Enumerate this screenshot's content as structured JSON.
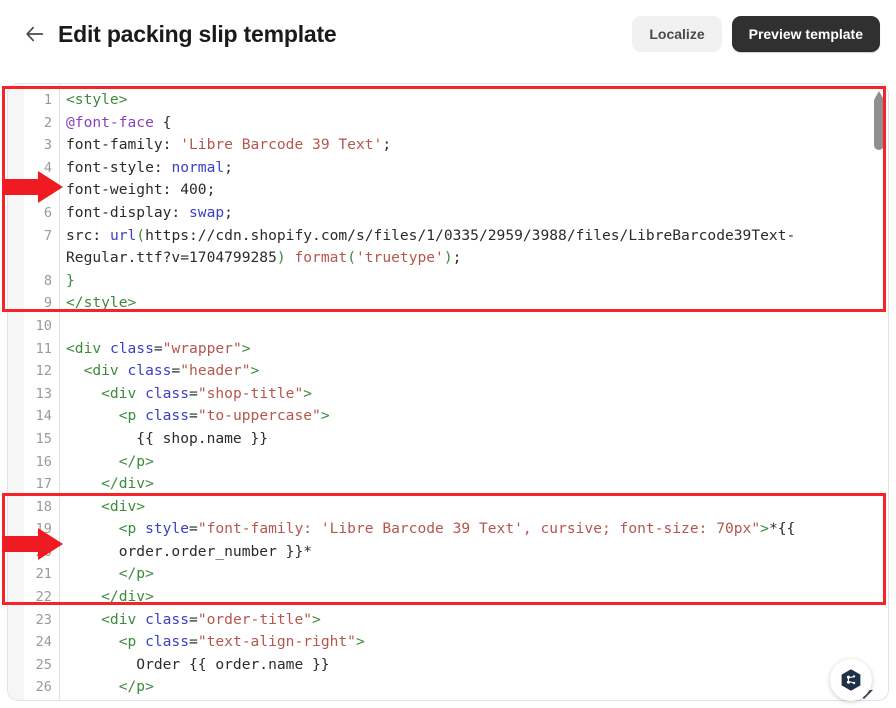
{
  "header": {
    "back_icon": "arrow-left-icon",
    "title": "Edit packing slip template",
    "localize_label": "Localize",
    "preview_label": "Preview template"
  },
  "editor": {
    "scrollbar": {
      "thumb_position_pct": 3,
      "up_arrow_icon": "scroll-up-arrow-icon"
    },
    "lines": [
      {
        "num": "1",
        "segments": [
          {
            "t": "<style>",
            "c": "tg"
          }
        ]
      },
      {
        "num": "2",
        "segments": [
          {
            "t": "@font-face",
            "c": "pu"
          },
          {
            "t": " ",
            "c": "nu"
          },
          {
            "t": "{",
            "c": "nu"
          }
        ]
      },
      {
        "num": "3",
        "segments": [
          {
            "t": "font-family: ",
            "c": "nu"
          },
          {
            "t": "'Libre Barcode 39 Text'",
            "c": "st"
          },
          {
            "t": ";",
            "c": "nu"
          }
        ]
      },
      {
        "num": "4",
        "segments": [
          {
            "t": "font-style: ",
            "c": "nu"
          },
          {
            "t": "normal",
            "c": "at"
          },
          {
            "t": ";",
            "c": "nu"
          }
        ]
      },
      {
        "num": "5",
        "segments": [
          {
            "t": "font-weight: ",
            "c": "nu"
          },
          {
            "t": "400",
            "c": "nu"
          },
          {
            "t": ";",
            "c": "nu"
          }
        ]
      },
      {
        "num": "6",
        "segments": [
          {
            "t": "font-display: ",
            "c": "nu"
          },
          {
            "t": "swap",
            "c": "at"
          },
          {
            "t": ";",
            "c": "nu"
          }
        ]
      },
      {
        "num": "7",
        "segments": [
          {
            "t": "src: ",
            "c": "nu"
          },
          {
            "t": "url",
            "c": "fn"
          },
          {
            "t": "(",
            "c": "gn"
          },
          {
            "t": "https://cdn.shopify.com/s/files/1/0335/2959/3988/files/LibreBarcode39Text-",
            "c": "nu"
          }
        ]
      },
      {
        "num": "",
        "segments": [
          {
            "t": "Regular.ttf?v=1704799285",
            "c": "nu"
          },
          {
            "t": ")",
            "c": "gn"
          },
          {
            "t": " ",
            "c": "nu"
          },
          {
            "t": "format",
            "c": "st"
          },
          {
            "t": "(",
            "c": "gn"
          },
          {
            "t": "'truetype'",
            "c": "st"
          },
          {
            "t": ")",
            "c": "gn"
          },
          {
            "t": ";",
            "c": "nu"
          }
        ]
      },
      {
        "num": "8",
        "segments": [
          {
            "t": "}",
            "c": "tg"
          }
        ]
      },
      {
        "num": "9",
        "segments": [
          {
            "t": "</style>",
            "c": "tg"
          }
        ]
      },
      {
        "num": "10",
        "segments": [
          {
            "t": "",
            "c": "nu"
          }
        ]
      },
      {
        "num": "11",
        "segments": [
          {
            "t": "<div ",
            "c": "tg"
          },
          {
            "t": "class",
            "c": "at"
          },
          {
            "t": "=",
            "c": "nu"
          },
          {
            "t": "\"wrapper\"",
            "c": "st"
          },
          {
            "t": ">",
            "c": "tg"
          }
        ]
      },
      {
        "num": "12",
        "segments": [
          {
            "t": "  <div ",
            "c": "tg"
          },
          {
            "t": "class",
            "c": "at"
          },
          {
            "t": "=",
            "c": "nu"
          },
          {
            "t": "\"header\"",
            "c": "st"
          },
          {
            "t": ">",
            "c": "tg"
          }
        ]
      },
      {
        "num": "13",
        "segments": [
          {
            "t": "    <div ",
            "c": "tg"
          },
          {
            "t": "class",
            "c": "at"
          },
          {
            "t": "=",
            "c": "nu"
          },
          {
            "t": "\"shop-title\"",
            "c": "st"
          },
          {
            "t": ">",
            "c": "tg"
          }
        ]
      },
      {
        "num": "14",
        "segments": [
          {
            "t": "      <p ",
            "c": "tg"
          },
          {
            "t": "class",
            "c": "at"
          },
          {
            "t": "=",
            "c": "nu"
          },
          {
            "t": "\"to-uppercase\"",
            "c": "st"
          },
          {
            "t": ">",
            "c": "tg"
          }
        ]
      },
      {
        "num": "15",
        "segments": [
          {
            "t": "        {{ shop.name }}",
            "c": "nu"
          }
        ]
      },
      {
        "num": "16",
        "segments": [
          {
            "t": "      </p>",
            "c": "tg"
          }
        ]
      },
      {
        "num": "17",
        "segments": [
          {
            "t": "    </div>",
            "c": "tg"
          }
        ]
      },
      {
        "num": "18",
        "segments": [
          {
            "t": "    <div>",
            "c": "tg"
          }
        ]
      },
      {
        "num": "19",
        "segments": [
          {
            "t": "      <p ",
            "c": "tg"
          },
          {
            "t": "style",
            "c": "at"
          },
          {
            "t": "=",
            "c": "nu"
          },
          {
            "t": "\"font-family: 'Libre Barcode 39 Text', cursive; font-size: 70px\"",
            "c": "st"
          },
          {
            "t": ">",
            "c": "tg"
          },
          {
            "t": "*{{",
            "c": "nu"
          }
        ]
      },
      {
        "num": "20",
        "segments": [
          {
            "t": "      order.order_number }}*",
            "c": "nu"
          }
        ]
      },
      {
        "num": "21",
        "segments": [
          {
            "t": "      </p>",
            "c": "tg"
          }
        ]
      },
      {
        "num": "22",
        "segments": [
          {
            "t": "    </div>",
            "c": "tg"
          }
        ]
      },
      {
        "num": "23",
        "segments": [
          {
            "t": "    <div ",
            "c": "tg"
          },
          {
            "t": "class",
            "c": "at"
          },
          {
            "t": "=",
            "c": "nu"
          },
          {
            "t": "\"order-title\"",
            "c": "st"
          },
          {
            "t": ">",
            "c": "tg"
          }
        ]
      },
      {
        "num": "24",
        "segments": [
          {
            "t": "      <p ",
            "c": "tg"
          },
          {
            "t": "class",
            "c": "at"
          },
          {
            "t": "=",
            "c": "nu"
          },
          {
            "t": "\"text-align-right\"",
            "c": "st"
          },
          {
            "t": ">",
            "c": "tg"
          }
        ]
      },
      {
        "num": "25",
        "segments": [
          {
            "t": "        Order {{ order.name }}",
            "c": "nu"
          }
        ]
      },
      {
        "num": "26",
        "segments": [
          {
            "t": "      </p>",
            "c": "tg"
          }
        ]
      }
    ]
  },
  "annotations": {
    "boxes": [
      {
        "label": "font-face-block-highlight"
      },
      {
        "label": "barcode-paragraph-highlight"
      }
    ],
    "arrows": [
      {
        "label": "arrow-pointing-to-line-5"
      },
      {
        "label": "arrow-pointing-to-line-19"
      }
    ],
    "box_color": "#f5232a",
    "arrow_color": "#ef1a22"
  },
  "chat_fab": {
    "icon": "chat-assistant-hexagon-icon",
    "icon_color": "#1f3147"
  }
}
